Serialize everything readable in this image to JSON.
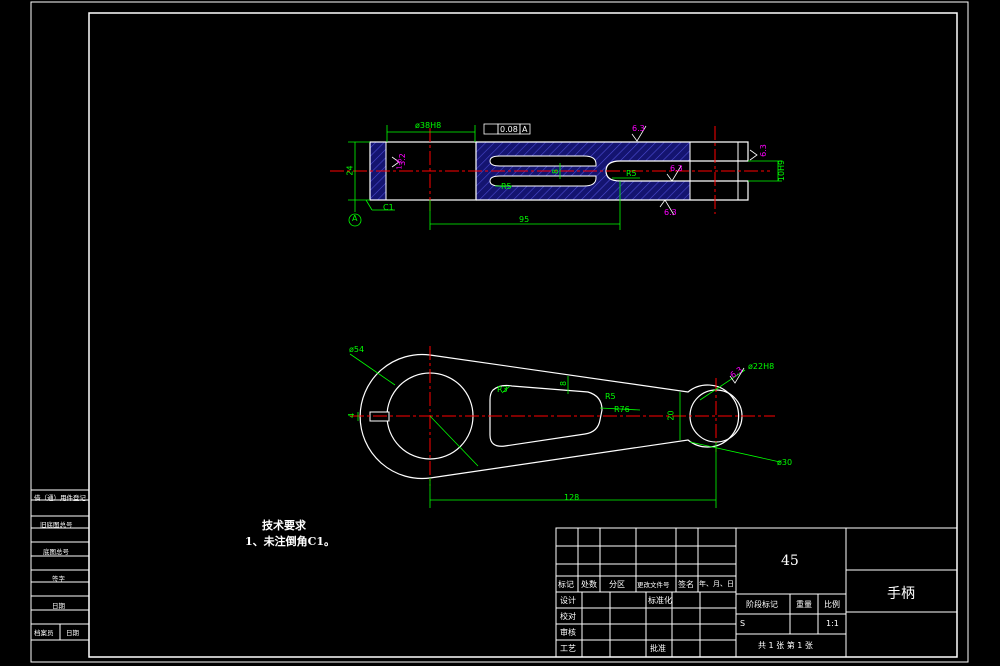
{
  "colors": {
    "background": "#000000",
    "outline": "#ffffff",
    "dimension": "#00ff00",
    "centerline": "#ff0000",
    "roughness": "#ff00ff",
    "hatch": "#1a1a8c"
  },
  "top_view": {
    "dim_bore": "ø38H8",
    "tolerance_value": "0.08",
    "tolerance_datum": "A",
    "roughness_1": "6.3",
    "roughness_2": "6.3",
    "roughness_3": "6.3",
    "roughness_4": "6.3",
    "roughness_5": "3.2",
    "roughness_6": "1.6",
    "dim_height": "24",
    "dim_r5_left": "R5",
    "dim_slot": "8",
    "dim_r5_right": "R5",
    "dim_right_bore": "10H9",
    "dim_chamfer": "C1",
    "datum_label": "A",
    "dim_length": "95"
  },
  "front_view": {
    "dim_d54": "ø54",
    "dim_r3": "R3",
    "dim_8": "8",
    "dim_r5": "R5",
    "dim_r76": "R76",
    "dim_20": "20",
    "dim_d22": "ø22H8",
    "dim_d30": "ø30",
    "dim_128": "128",
    "dim_4": "4",
    "roughness": "6.3"
  },
  "notes": {
    "title": "技术要求",
    "line1": "1、未注倒角C1。"
  },
  "side_block": {
    "r1": "借（通）用件登记",
    "r2": "旧底图总号",
    "r3": "底图总号",
    "r4": "签字",
    "r5": "日期",
    "r6a": "档案员",
    "r6b": "日期"
  },
  "title_block": {
    "material": "45",
    "part_name": "手柄",
    "h_mark": "标记",
    "h_count": "处数",
    "h_zone": "分区",
    "h_docno": "更改文件号",
    "h_sign": "签名",
    "h_date": "年、月、日",
    "design": "设计",
    "standard": "标准化",
    "check": "校对",
    "review": "审核",
    "process": "工艺",
    "approve": "批准",
    "stage": "阶段标记",
    "weight": "重量",
    "scale_h": "比例",
    "stage_val": "S",
    "scale_val": "1:1",
    "sheets": "共 1 张  第 1 张"
  }
}
